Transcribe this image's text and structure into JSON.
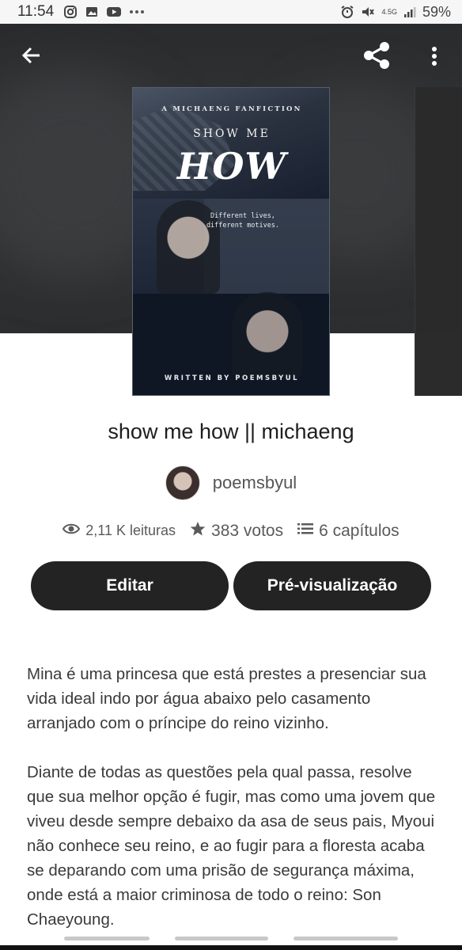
{
  "status_bar": {
    "time": "11:54",
    "battery": "59%",
    "network": "4.5G"
  },
  "header": {
    "back_icon": "arrow-left-icon",
    "share_icon": "share-icon",
    "more_icon": "more-vertical-icon"
  },
  "cover": {
    "kicker": "A MICHAENG FANFICTION",
    "subtitle": "SHOW ME",
    "title": "HOW",
    "tagline": "Different lives, different motives.",
    "author_line": "WRITTEN BY POEMSBYUL"
  },
  "story": {
    "title": "show me how || michaeng",
    "author": "poemsbyul",
    "reads": "2,11 K leituras",
    "votes": "383 votos",
    "chapters": "6 capítulos"
  },
  "actions": {
    "edit_label": "Editar",
    "preview_label": "Pré-visualização"
  },
  "description": {
    "paragraph_1": "Mina é uma princesa que está prestes a presenciar sua vida ideal indo por água abaixo pelo casamento arranjado com o príncipe do reino vizinho.",
    "paragraph_2": "Diante de todas as questões pela qual passa, resolve que sua melhor opção é fugir, mas como uma jovem que viveu desde sempre debaixo da asa de seus pais, Myoui não conhece seu reino, e ao fugir para a floresta acaba se deparando com uma prisão de segurança máxima, onde está a maior criminosa de todo o reino: Son Chaeyoung."
  },
  "colors": {
    "button_bg": "#232323",
    "hero_bg": "#2c2d2f"
  }
}
